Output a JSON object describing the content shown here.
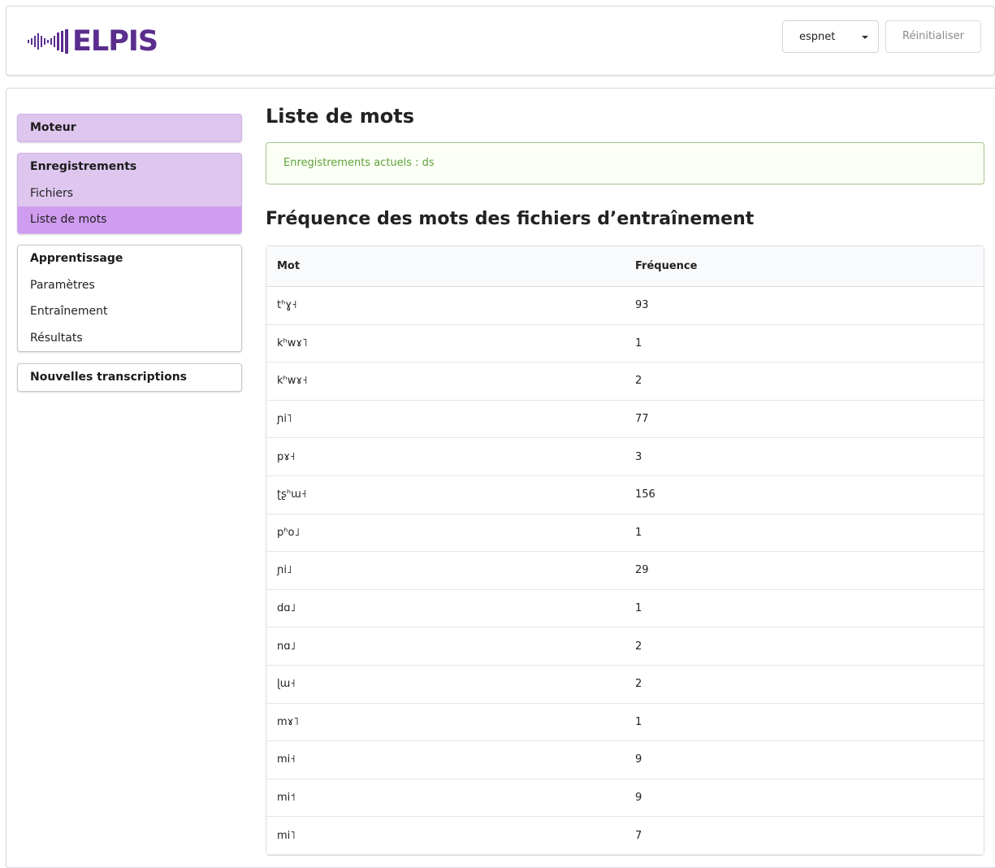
{
  "app": {
    "logo_text": "ELPIS"
  },
  "toolbar": {
    "engine_selected": "espnet",
    "reset_label": "Réinitialiser"
  },
  "sidebar": {
    "engine": "Moteur",
    "recordings": {
      "title": "Enregistrements",
      "items": [
        "Fichiers",
        "Liste de mots"
      ],
      "active": "Liste de mots"
    },
    "training": {
      "title": "Apprentissage",
      "items": [
        "Paramètres",
        "Entraînement",
        "Résultats"
      ]
    },
    "new_transcriptions": "Nouvelles transcriptions"
  },
  "main": {
    "title": "Liste de mots",
    "current_recordings": "Enregistrements actuels : ds",
    "section_title": "Fréquence des mots des fichiers d’entraînement",
    "table": {
      "headers": [
        "Mot",
        "Fréquence"
      ],
      "rows": [
        [
          "tʰɣ˧",
          "93"
        ],
        [
          "kʰwɤ˥",
          "1"
        ],
        [
          "kʰwɤ˧",
          "2"
        ],
        [
          "ɲi˥",
          "77"
        ],
        [
          "pɤ˧",
          "3"
        ],
        [
          "ʈʂʰɯ˧",
          "156"
        ],
        [
          "pʰo˩",
          "1"
        ],
        [
          "ɲi˩",
          "29"
        ],
        [
          "dɑ˩",
          "1"
        ],
        [
          "nɑ˩",
          "2"
        ],
        [
          "ɭɯ˧",
          "2"
        ],
        [
          "mɤ˥",
          "1"
        ],
        [
          "mi˧",
          "9"
        ],
        [
          "mi˦",
          "9"
        ],
        [
          "mi˥",
          "7"
        ]
      ]
    }
  },
  "colors": {
    "brand": "#5b2d8e",
    "menu_bg": "#dfc6ef",
    "menu_active": "#cf9cf0",
    "alert_text": "#5ea33c"
  },
  "icons": {
    "logo_waveform": "waveform-icon",
    "dropdown": "caret-down-icon"
  }
}
